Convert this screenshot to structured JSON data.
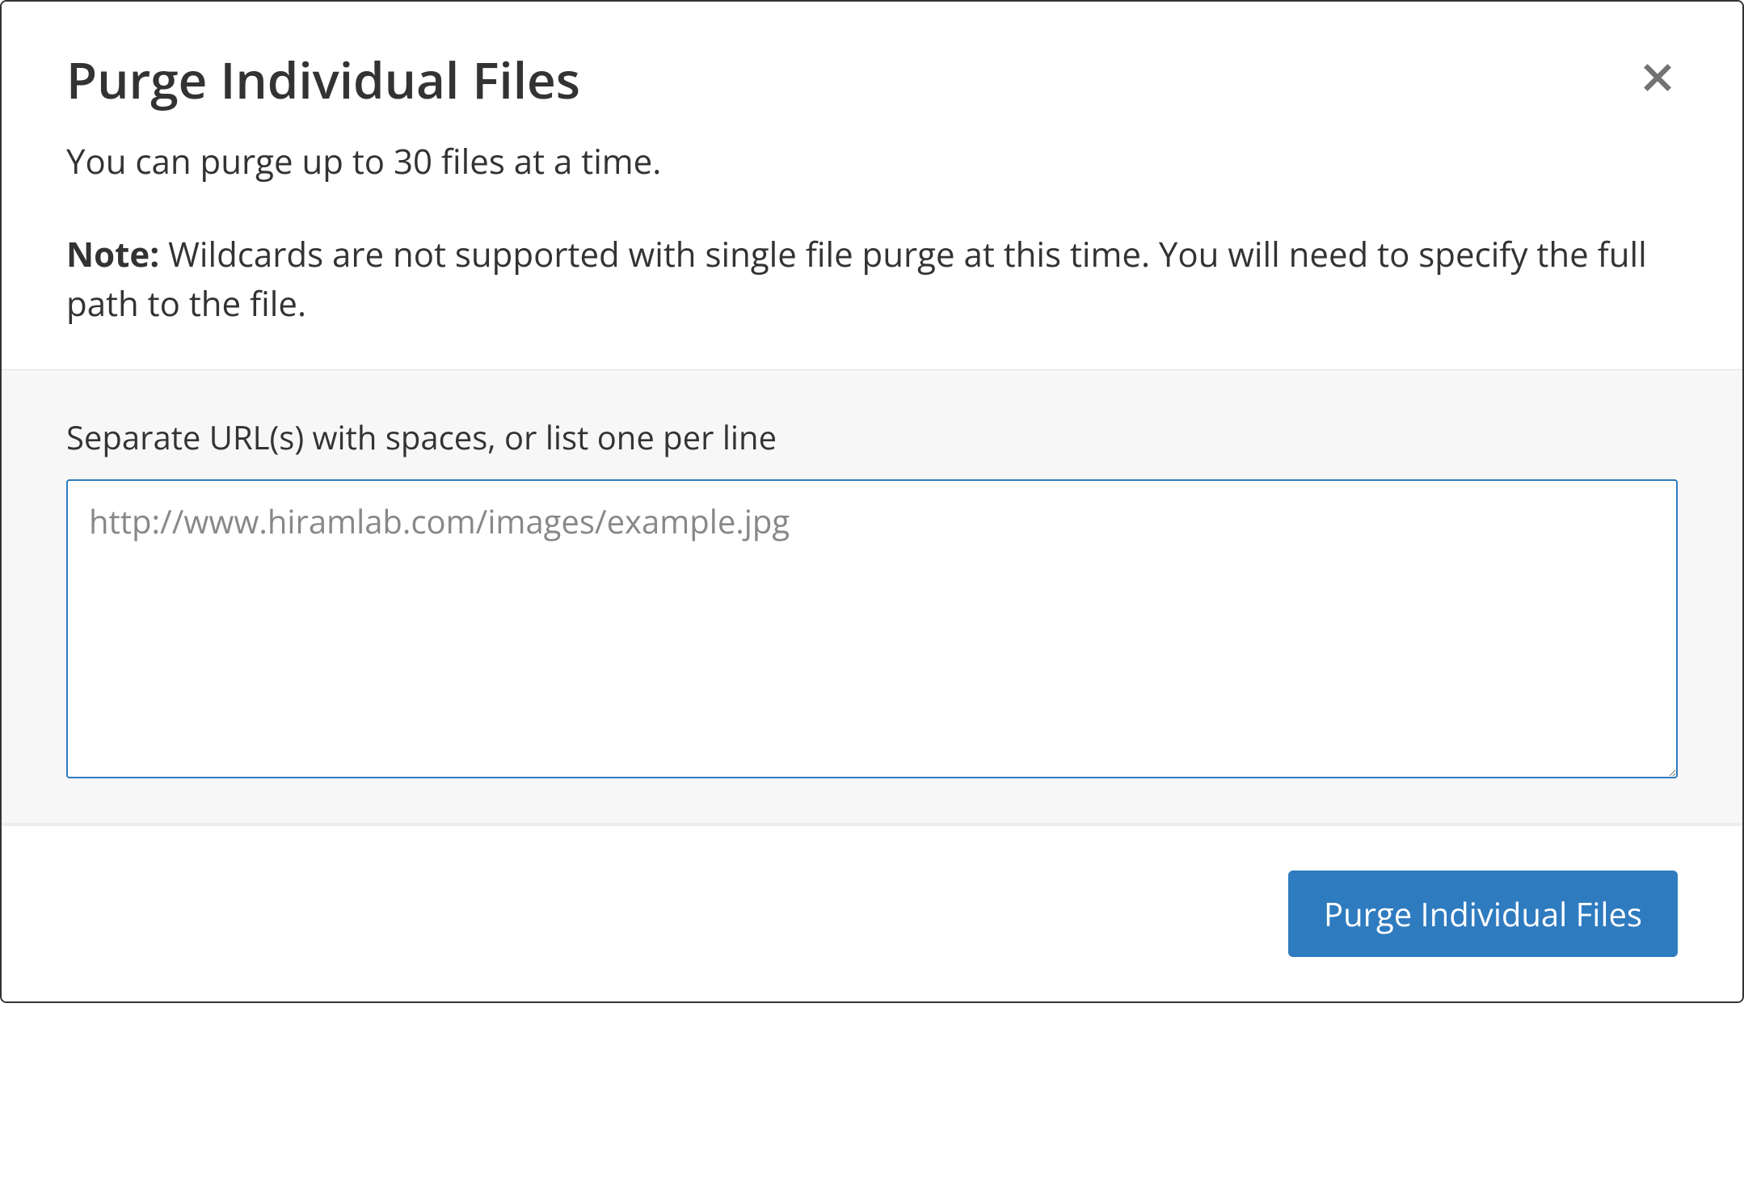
{
  "modal": {
    "title": "Purge Individual Files",
    "subtitle": "You can purge up to 30 files at a time.",
    "note_label": "Note:",
    "note_text": " Wildcards are not supported with single file purge at this time. You will need to specify the full path to the file."
  },
  "form": {
    "label": "Separate URL(s) with spaces, or list one per line",
    "placeholder": "http://www.hiramlab.com/images/example.jpg",
    "value": ""
  },
  "footer": {
    "submit_label": "Purge Individual Files"
  },
  "colors": {
    "primary": "#2f7bbf",
    "body_bg": "#f7f7f7",
    "text": "#333333",
    "placeholder": "#888888"
  }
}
